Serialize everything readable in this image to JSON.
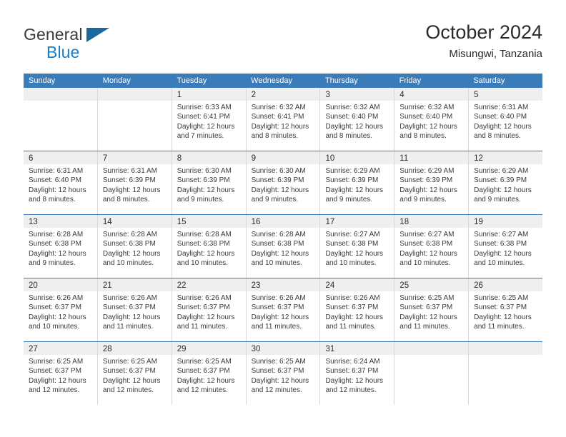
{
  "brand": {
    "name_top": "General",
    "name_bottom": "Blue",
    "color_dark": "#3b3b3b",
    "color_blue": "#1a7dc4",
    "triangle_color": "#17699e"
  },
  "header": {
    "title": "October 2024",
    "subtitle": "Misungwi, Tanzania"
  },
  "theme": {
    "header_blue": "#3a7cba",
    "daynum_band": "#efefef",
    "cell_border": "#d8d8d8",
    "text": "#3a3a3a"
  },
  "weekday_headers": [
    "Sunday",
    "Monday",
    "Tuesday",
    "Wednesday",
    "Thursday",
    "Friday",
    "Saturday"
  ],
  "labels": {
    "sunrise_prefix": "Sunrise: ",
    "sunset_prefix": "Sunset: ",
    "daylight_prefix": "Daylight: "
  },
  "weeks": [
    [
      {
        "day": "",
        "sunrise": "",
        "sunset": "",
        "daylight_line1": "",
        "daylight_line2": ""
      },
      {
        "day": "",
        "sunrise": "",
        "sunset": "",
        "daylight_line1": "",
        "daylight_line2": ""
      },
      {
        "day": "1",
        "sunrise": "Sunrise: 6:33 AM",
        "sunset": "Sunset: 6:41 PM",
        "daylight_line1": "Daylight: 12 hours",
        "daylight_line2": "and 7 minutes."
      },
      {
        "day": "2",
        "sunrise": "Sunrise: 6:32 AM",
        "sunset": "Sunset: 6:41 PM",
        "daylight_line1": "Daylight: 12 hours",
        "daylight_line2": "and 8 minutes."
      },
      {
        "day": "3",
        "sunrise": "Sunrise: 6:32 AM",
        "sunset": "Sunset: 6:40 PM",
        "daylight_line1": "Daylight: 12 hours",
        "daylight_line2": "and 8 minutes."
      },
      {
        "day": "4",
        "sunrise": "Sunrise: 6:32 AM",
        "sunset": "Sunset: 6:40 PM",
        "daylight_line1": "Daylight: 12 hours",
        "daylight_line2": "and 8 minutes."
      },
      {
        "day": "5",
        "sunrise": "Sunrise: 6:31 AM",
        "sunset": "Sunset: 6:40 PM",
        "daylight_line1": "Daylight: 12 hours",
        "daylight_line2": "and 8 minutes."
      }
    ],
    [
      {
        "day": "6",
        "sunrise": "Sunrise: 6:31 AM",
        "sunset": "Sunset: 6:40 PM",
        "daylight_line1": "Daylight: 12 hours",
        "daylight_line2": "and 8 minutes."
      },
      {
        "day": "7",
        "sunrise": "Sunrise: 6:31 AM",
        "sunset": "Sunset: 6:39 PM",
        "daylight_line1": "Daylight: 12 hours",
        "daylight_line2": "and 8 minutes."
      },
      {
        "day": "8",
        "sunrise": "Sunrise: 6:30 AM",
        "sunset": "Sunset: 6:39 PM",
        "daylight_line1": "Daylight: 12 hours",
        "daylight_line2": "and 9 minutes."
      },
      {
        "day": "9",
        "sunrise": "Sunrise: 6:30 AM",
        "sunset": "Sunset: 6:39 PM",
        "daylight_line1": "Daylight: 12 hours",
        "daylight_line2": "and 9 minutes."
      },
      {
        "day": "10",
        "sunrise": "Sunrise: 6:29 AM",
        "sunset": "Sunset: 6:39 PM",
        "daylight_line1": "Daylight: 12 hours",
        "daylight_line2": "and 9 minutes."
      },
      {
        "day": "11",
        "sunrise": "Sunrise: 6:29 AM",
        "sunset": "Sunset: 6:39 PM",
        "daylight_line1": "Daylight: 12 hours",
        "daylight_line2": "and 9 minutes."
      },
      {
        "day": "12",
        "sunrise": "Sunrise: 6:29 AM",
        "sunset": "Sunset: 6:39 PM",
        "daylight_line1": "Daylight: 12 hours",
        "daylight_line2": "and 9 minutes."
      }
    ],
    [
      {
        "day": "13",
        "sunrise": "Sunrise: 6:28 AM",
        "sunset": "Sunset: 6:38 PM",
        "daylight_line1": "Daylight: 12 hours",
        "daylight_line2": "and 9 minutes."
      },
      {
        "day": "14",
        "sunrise": "Sunrise: 6:28 AM",
        "sunset": "Sunset: 6:38 PM",
        "daylight_line1": "Daylight: 12 hours",
        "daylight_line2": "and 10 minutes."
      },
      {
        "day": "15",
        "sunrise": "Sunrise: 6:28 AM",
        "sunset": "Sunset: 6:38 PM",
        "daylight_line1": "Daylight: 12 hours",
        "daylight_line2": "and 10 minutes."
      },
      {
        "day": "16",
        "sunrise": "Sunrise: 6:28 AM",
        "sunset": "Sunset: 6:38 PM",
        "daylight_line1": "Daylight: 12 hours",
        "daylight_line2": "and 10 minutes."
      },
      {
        "day": "17",
        "sunrise": "Sunrise: 6:27 AM",
        "sunset": "Sunset: 6:38 PM",
        "daylight_line1": "Daylight: 12 hours",
        "daylight_line2": "and 10 minutes."
      },
      {
        "day": "18",
        "sunrise": "Sunrise: 6:27 AM",
        "sunset": "Sunset: 6:38 PM",
        "daylight_line1": "Daylight: 12 hours",
        "daylight_line2": "and 10 minutes."
      },
      {
        "day": "19",
        "sunrise": "Sunrise: 6:27 AM",
        "sunset": "Sunset: 6:38 PM",
        "daylight_line1": "Daylight: 12 hours",
        "daylight_line2": "and 10 minutes."
      }
    ],
    [
      {
        "day": "20",
        "sunrise": "Sunrise: 6:26 AM",
        "sunset": "Sunset: 6:37 PM",
        "daylight_line1": "Daylight: 12 hours",
        "daylight_line2": "and 10 minutes."
      },
      {
        "day": "21",
        "sunrise": "Sunrise: 6:26 AM",
        "sunset": "Sunset: 6:37 PM",
        "daylight_line1": "Daylight: 12 hours",
        "daylight_line2": "and 11 minutes."
      },
      {
        "day": "22",
        "sunrise": "Sunrise: 6:26 AM",
        "sunset": "Sunset: 6:37 PM",
        "daylight_line1": "Daylight: 12 hours",
        "daylight_line2": "and 11 minutes."
      },
      {
        "day": "23",
        "sunrise": "Sunrise: 6:26 AM",
        "sunset": "Sunset: 6:37 PM",
        "daylight_line1": "Daylight: 12 hours",
        "daylight_line2": "and 11 minutes."
      },
      {
        "day": "24",
        "sunrise": "Sunrise: 6:26 AM",
        "sunset": "Sunset: 6:37 PM",
        "daylight_line1": "Daylight: 12 hours",
        "daylight_line2": "and 11 minutes."
      },
      {
        "day": "25",
        "sunrise": "Sunrise: 6:25 AM",
        "sunset": "Sunset: 6:37 PM",
        "daylight_line1": "Daylight: 12 hours",
        "daylight_line2": "and 11 minutes."
      },
      {
        "day": "26",
        "sunrise": "Sunrise: 6:25 AM",
        "sunset": "Sunset: 6:37 PM",
        "daylight_line1": "Daylight: 12 hours",
        "daylight_line2": "and 11 minutes."
      }
    ],
    [
      {
        "day": "27",
        "sunrise": "Sunrise: 6:25 AM",
        "sunset": "Sunset: 6:37 PM",
        "daylight_line1": "Daylight: 12 hours",
        "daylight_line2": "and 12 minutes."
      },
      {
        "day": "28",
        "sunrise": "Sunrise: 6:25 AM",
        "sunset": "Sunset: 6:37 PM",
        "daylight_line1": "Daylight: 12 hours",
        "daylight_line2": "and 12 minutes."
      },
      {
        "day": "29",
        "sunrise": "Sunrise: 6:25 AM",
        "sunset": "Sunset: 6:37 PM",
        "daylight_line1": "Daylight: 12 hours",
        "daylight_line2": "and 12 minutes."
      },
      {
        "day": "30",
        "sunrise": "Sunrise: 6:25 AM",
        "sunset": "Sunset: 6:37 PM",
        "daylight_line1": "Daylight: 12 hours",
        "daylight_line2": "and 12 minutes."
      },
      {
        "day": "31",
        "sunrise": "Sunrise: 6:24 AM",
        "sunset": "Sunset: 6:37 PM",
        "daylight_line1": "Daylight: 12 hours",
        "daylight_line2": "and 12 minutes."
      },
      {
        "day": "",
        "sunrise": "",
        "sunset": "",
        "daylight_line1": "",
        "daylight_line2": ""
      },
      {
        "day": "",
        "sunrise": "",
        "sunset": "",
        "daylight_line1": "",
        "daylight_line2": ""
      }
    ]
  ]
}
